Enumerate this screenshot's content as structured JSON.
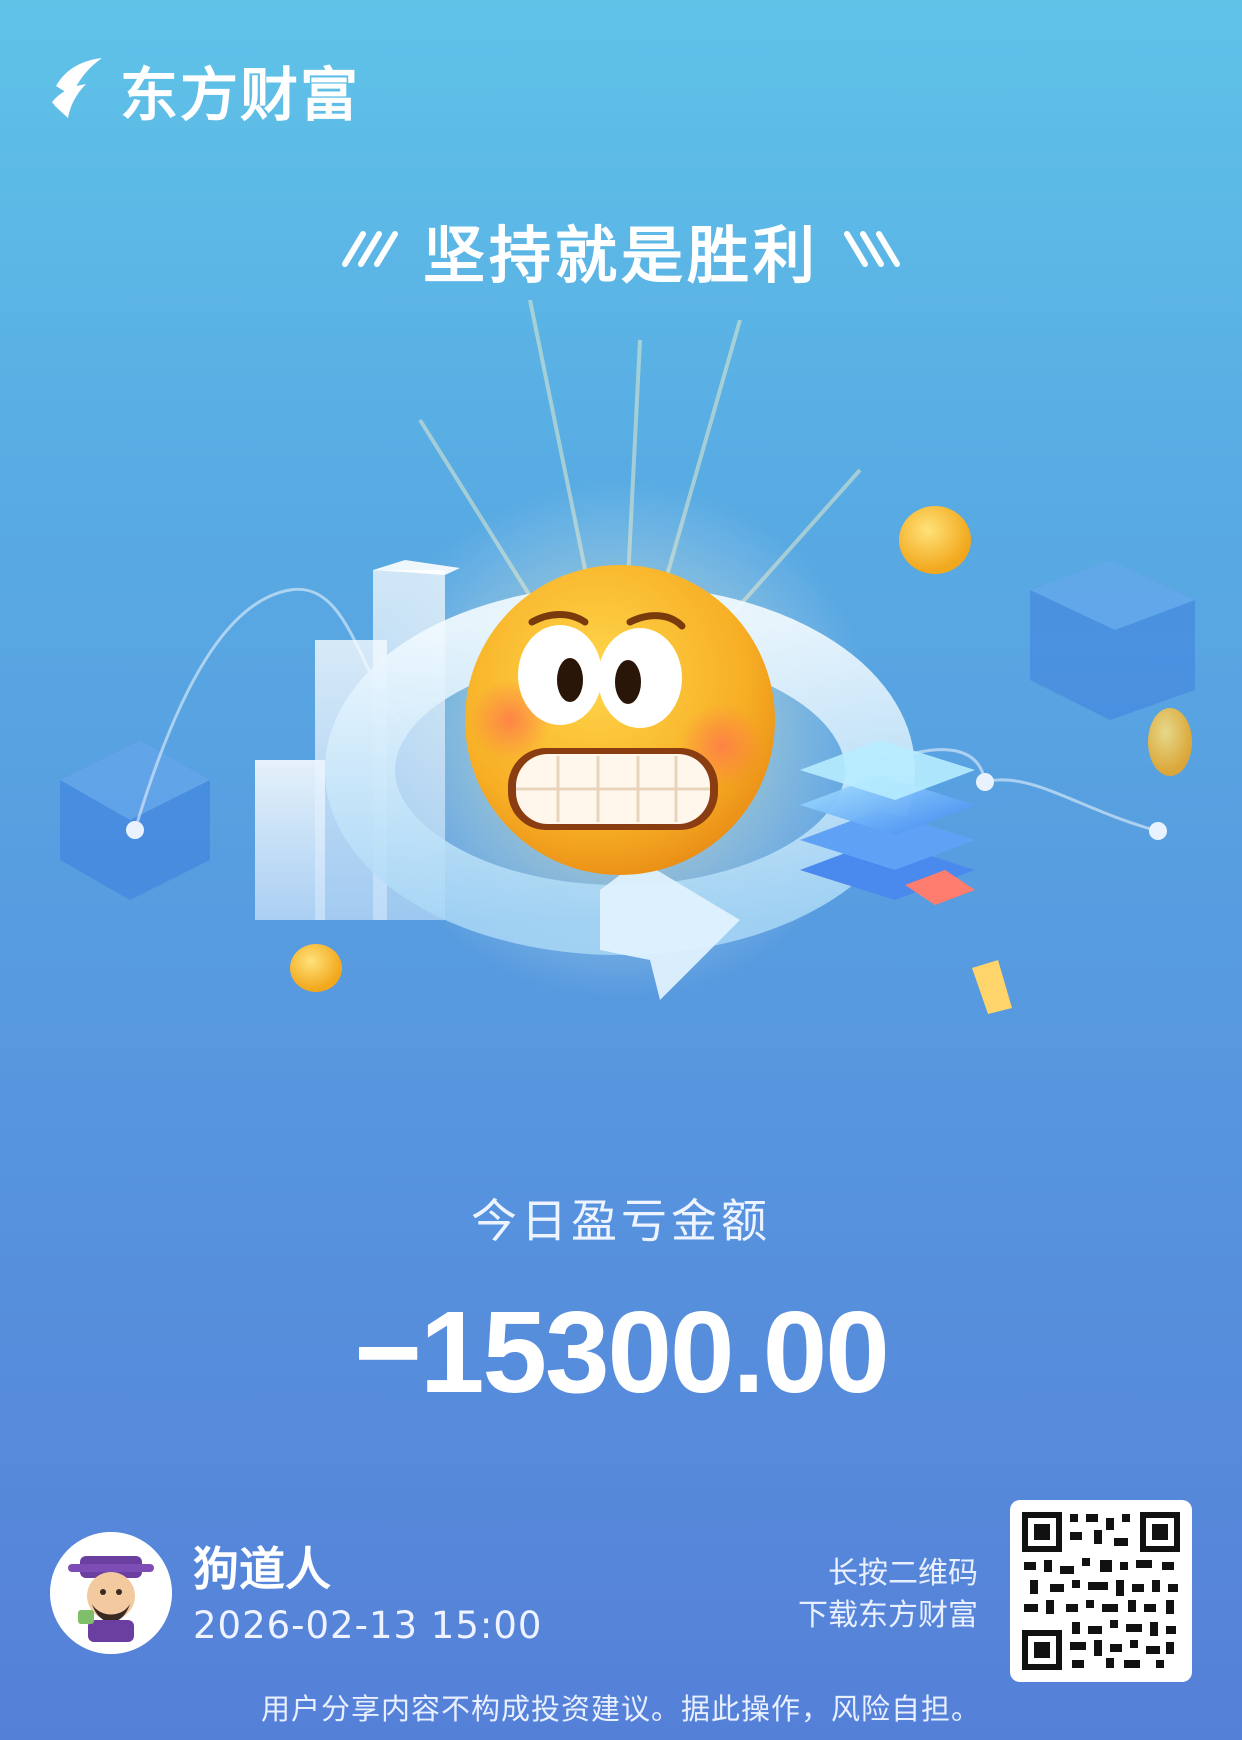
{
  "brand": {
    "name": "东方财富",
    "logo_icon": "eastmoney-logo-icon"
  },
  "slogan": {
    "text": "坚持就是胜利",
    "left_icon": "slash-stripes-icon",
    "right_icon": "backslash-stripes-icon"
  },
  "hero": {
    "illustration": "grimacing-emoji-illustration"
  },
  "pnl": {
    "label": "今日盈亏金额",
    "value": "−15300.00"
  },
  "user": {
    "name": "狗道人",
    "datetime": "2026-02-13 15:00",
    "avatar_icon": "caishen-avatar-icon"
  },
  "qr": {
    "line1": "长按二维码",
    "line2": "下载东方财富",
    "icon": "qr-code-icon"
  },
  "footer": {
    "disclaimer": "用户分享内容不构成投资建议。据此操作，风险自担。"
  },
  "colors": {
    "bg_top": "#5fc3e8",
    "bg_bottom": "#5580d8",
    "emoji": "#f6a91f",
    "text": "#ffffff"
  }
}
